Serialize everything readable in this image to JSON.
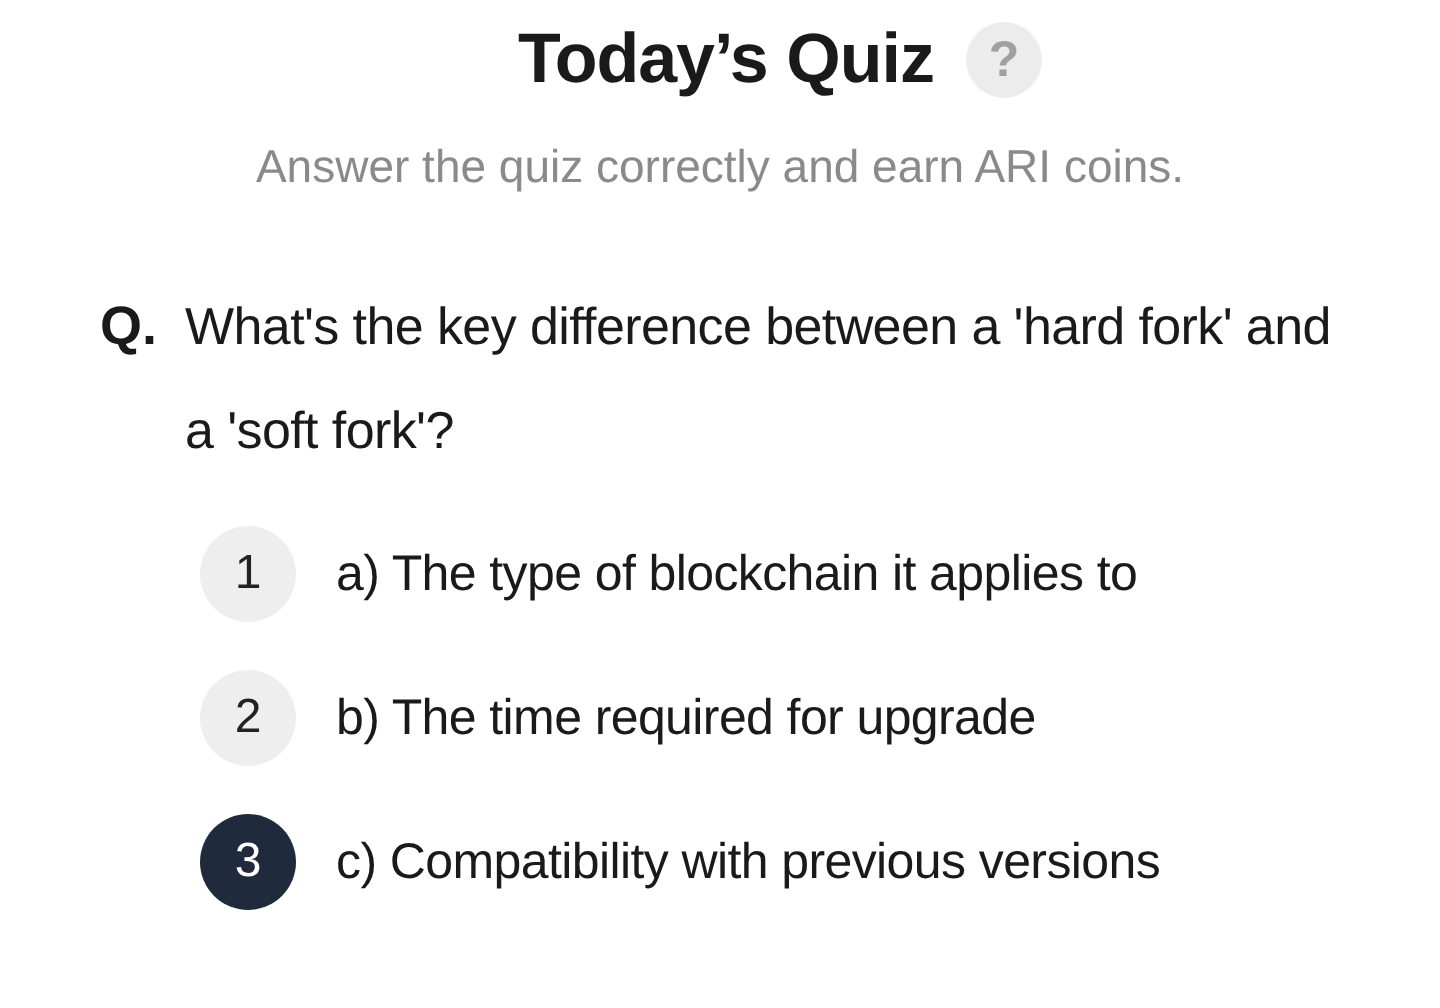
{
  "title": "Today’s Quiz",
  "help_icon": "?",
  "subtitle": "Answer the quiz correctly and earn ARI coins.",
  "question": {
    "prefix": "Q.",
    "text": "What's the key difference between a 'hard fork' and a 'soft fork'?"
  },
  "options": [
    {
      "number": "1",
      "text": "a) The type of blockchain it applies to",
      "selected": false
    },
    {
      "number": "2",
      "text": "b) The time required for upgrade",
      "selected": false
    },
    {
      "number": "3",
      "text": "c) Compatibility with previous versions",
      "selected": true
    }
  ]
}
